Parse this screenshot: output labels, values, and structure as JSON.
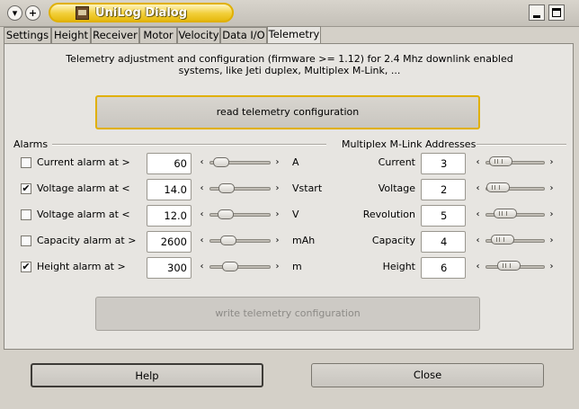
{
  "window": {
    "title": "UniLog Dialog",
    "left_buttons": [
      "menu-icon",
      "plus-icon"
    ],
    "right_buttons": [
      "minimize-icon",
      "maximize-icon"
    ]
  },
  "tabs": [
    {
      "label": "Settings",
      "active": false
    },
    {
      "label": "Height",
      "active": false
    },
    {
      "label": "Receiver",
      "active": false
    },
    {
      "label": "Motor",
      "active": false
    },
    {
      "label": "Velocity",
      "active": false
    },
    {
      "label": "Data I/O",
      "active": false
    },
    {
      "label": "Telemetry",
      "active": true
    }
  ],
  "telemetry": {
    "description_line1": "Telemetry adjustment and configuration (firmware >= 1.12) for 2.4 Mhz downlink enabled",
    "description_line2": "systems, like Jeti duplex, Multiplex M-Link, ...",
    "read_button": "read telemetry configuration",
    "write_button": "write telemetry configuration",
    "alarms": {
      "title": "Alarms",
      "rows": [
        {
          "label": "Current alarm at >",
          "checked": false,
          "value": "60",
          "unit": "A",
          "slider_fraction": 0.25
        },
        {
          "label": "Voltage alarm at <",
          "checked": true,
          "value": "14.0",
          "unit": "Vstart",
          "slider_fraction": 0.28
        },
        {
          "label": "Voltage alarm at <",
          "checked": false,
          "value": "12.0",
          "unit": "V",
          "slider_fraction": 0.27
        },
        {
          "label": "Capacity alarm at >",
          "checked": false,
          "value": "2600",
          "unit": "mAh",
          "slider_fraction": 0.31
        },
        {
          "label": "Height alarm at >",
          "checked": true,
          "value": "300",
          "unit": "m",
          "slider_fraction": 0.36
        }
      ]
    },
    "mlink": {
      "title": "Multiplex M-Link Addresses",
      "rows": [
        {
          "label": "Current",
          "value": "3",
          "slider_fraction": 0.2
        },
        {
          "label": "Voltage",
          "value": "2",
          "slider_fraction": 0.13
        },
        {
          "label": "Revolution",
          "value": "5",
          "slider_fraction": 0.33
        },
        {
          "label": "Capacity",
          "value": "4",
          "slider_fraction": 0.27
        },
        {
          "label": "Height",
          "value": "6",
          "slider_fraction": 0.4
        }
      ]
    }
  },
  "footer": {
    "help_button": "Help",
    "close_button": "Close"
  },
  "colors": {
    "window_bg": "#d4d0c8",
    "title_accent": "#e6ba10",
    "focus_border": "#e0b000"
  }
}
